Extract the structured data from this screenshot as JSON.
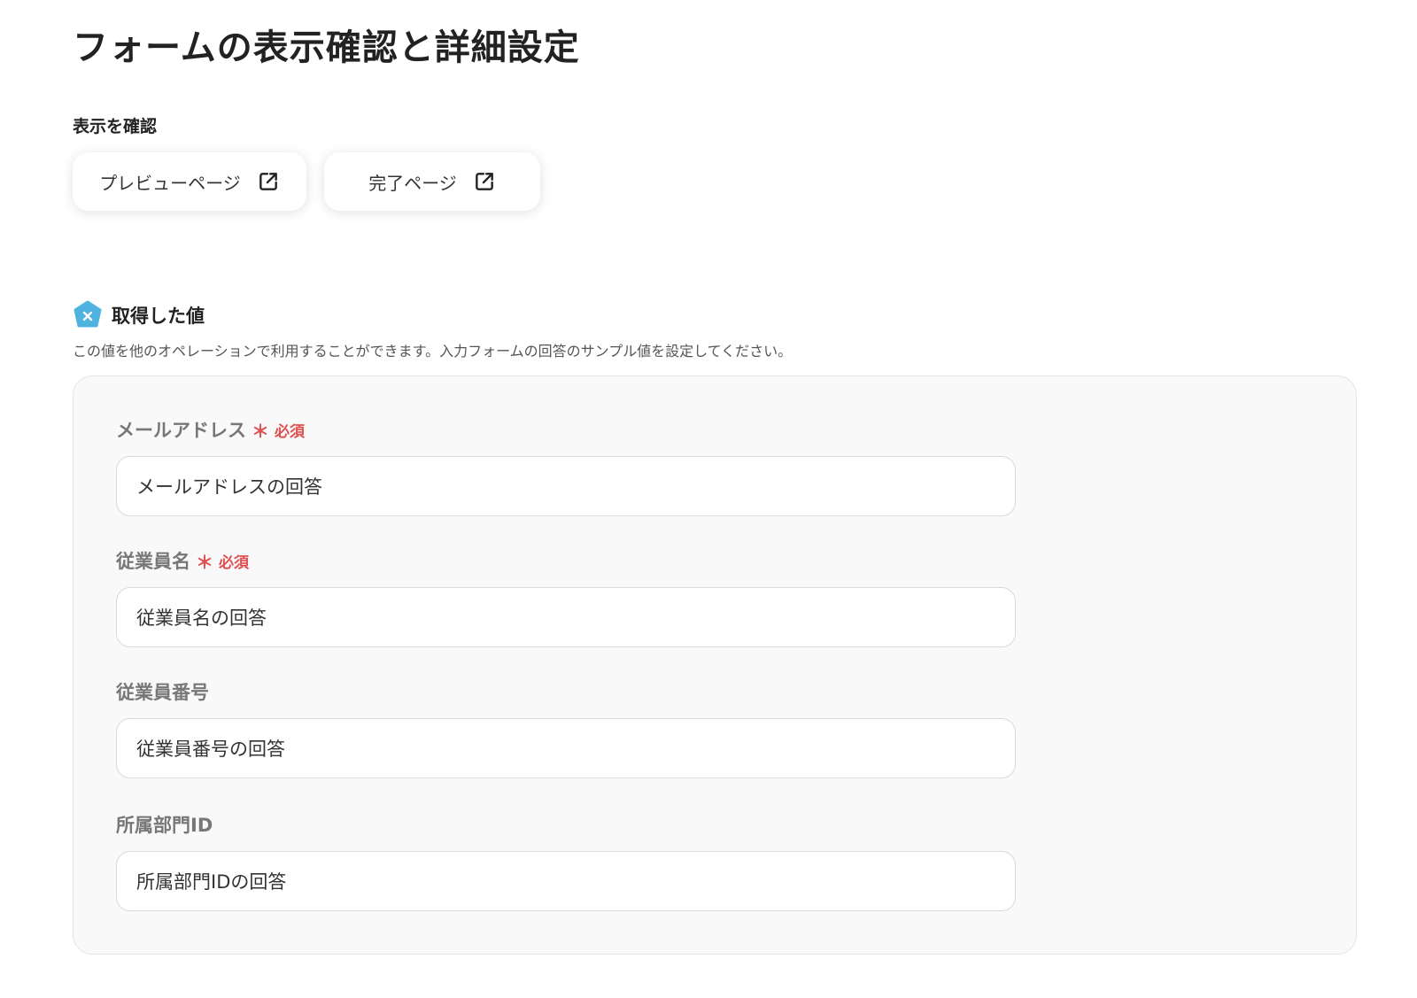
{
  "page": {
    "title": "フォームの表示確認と詳細設定"
  },
  "view_section": {
    "label": "表示を確認",
    "buttons": [
      {
        "label": "プレビューページ",
        "icon": "external-link-icon"
      },
      {
        "label": "完了ページ",
        "icon": "external-link-icon"
      }
    ]
  },
  "values_section": {
    "icon": "badge-x-icon",
    "icon_color": "#4fb3e0",
    "title": "取得した値",
    "description": "この値を他のオペレーションで利用することができます。入力フォームの回答のサンプル値を設定してください。",
    "fields": [
      {
        "label": "メールアドレス",
        "required": true,
        "required_mark": "＊",
        "required_text": "必須",
        "value": "メールアドレスの回答"
      },
      {
        "label": "従業員名",
        "required": true,
        "required_mark": "＊",
        "required_text": "必須",
        "value": "従業員名の回答"
      },
      {
        "label": "従業員番号",
        "required": false,
        "value": "従業員番号の回答"
      },
      {
        "label": "所属部門ID",
        "required": false,
        "value": "所属部門IDの回答"
      }
    ]
  },
  "colors": {
    "required": "#e04f4f",
    "panel_background": "#f9f9f9",
    "field_label": "#777777"
  }
}
